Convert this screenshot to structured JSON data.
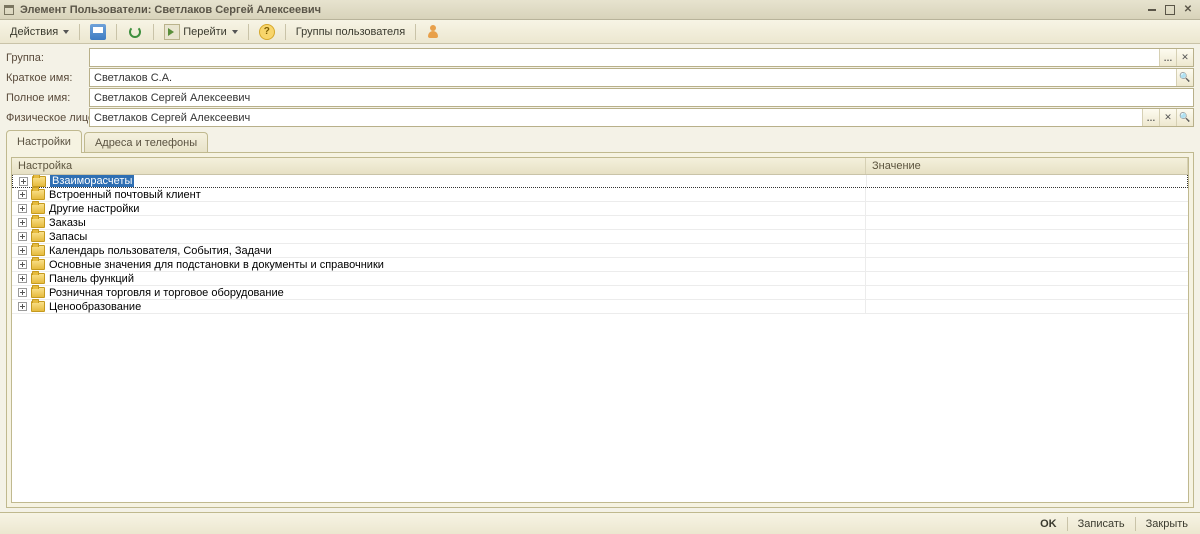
{
  "title": "Элемент Пользователи: Светлаков Сергей Алексеевич",
  "toolbar": {
    "actions": "Действия",
    "goto": "Перейти",
    "groups": "Группы пользователя"
  },
  "form": {
    "group_label": "Группа:",
    "group_value": "",
    "shortname_label": "Краткое имя:",
    "shortname_value": "Светлаков С.А.",
    "fullname_label": "Полное имя:",
    "fullname_value": "Светлаков Сергей Алексеевич",
    "person_label": "Физическое лицо:",
    "person_value": "Светлаков Сергей Алексеевич"
  },
  "tabs": {
    "settings": "Настройки",
    "addresses": "Адреса и телефоны"
  },
  "grid": {
    "col1": "Настройка",
    "col2": "Значение",
    "rows": [
      {
        "label": "Взаиморасчеты",
        "selected": true
      },
      {
        "label": "Встроенный почтовый клиент"
      },
      {
        "label": "Другие настройки"
      },
      {
        "label": "Заказы"
      },
      {
        "label": "Запасы"
      },
      {
        "label": "Календарь пользователя, События, Задачи"
      },
      {
        "label": "Основные значения для подстановки в документы и справочники"
      },
      {
        "label": "Панель функций"
      },
      {
        "label": "Розничная торговля и торговое оборудование"
      },
      {
        "label": "Ценообразование"
      }
    ]
  },
  "footer": {
    "ok": "OK",
    "save": "Записать",
    "close": "Закрыть"
  }
}
